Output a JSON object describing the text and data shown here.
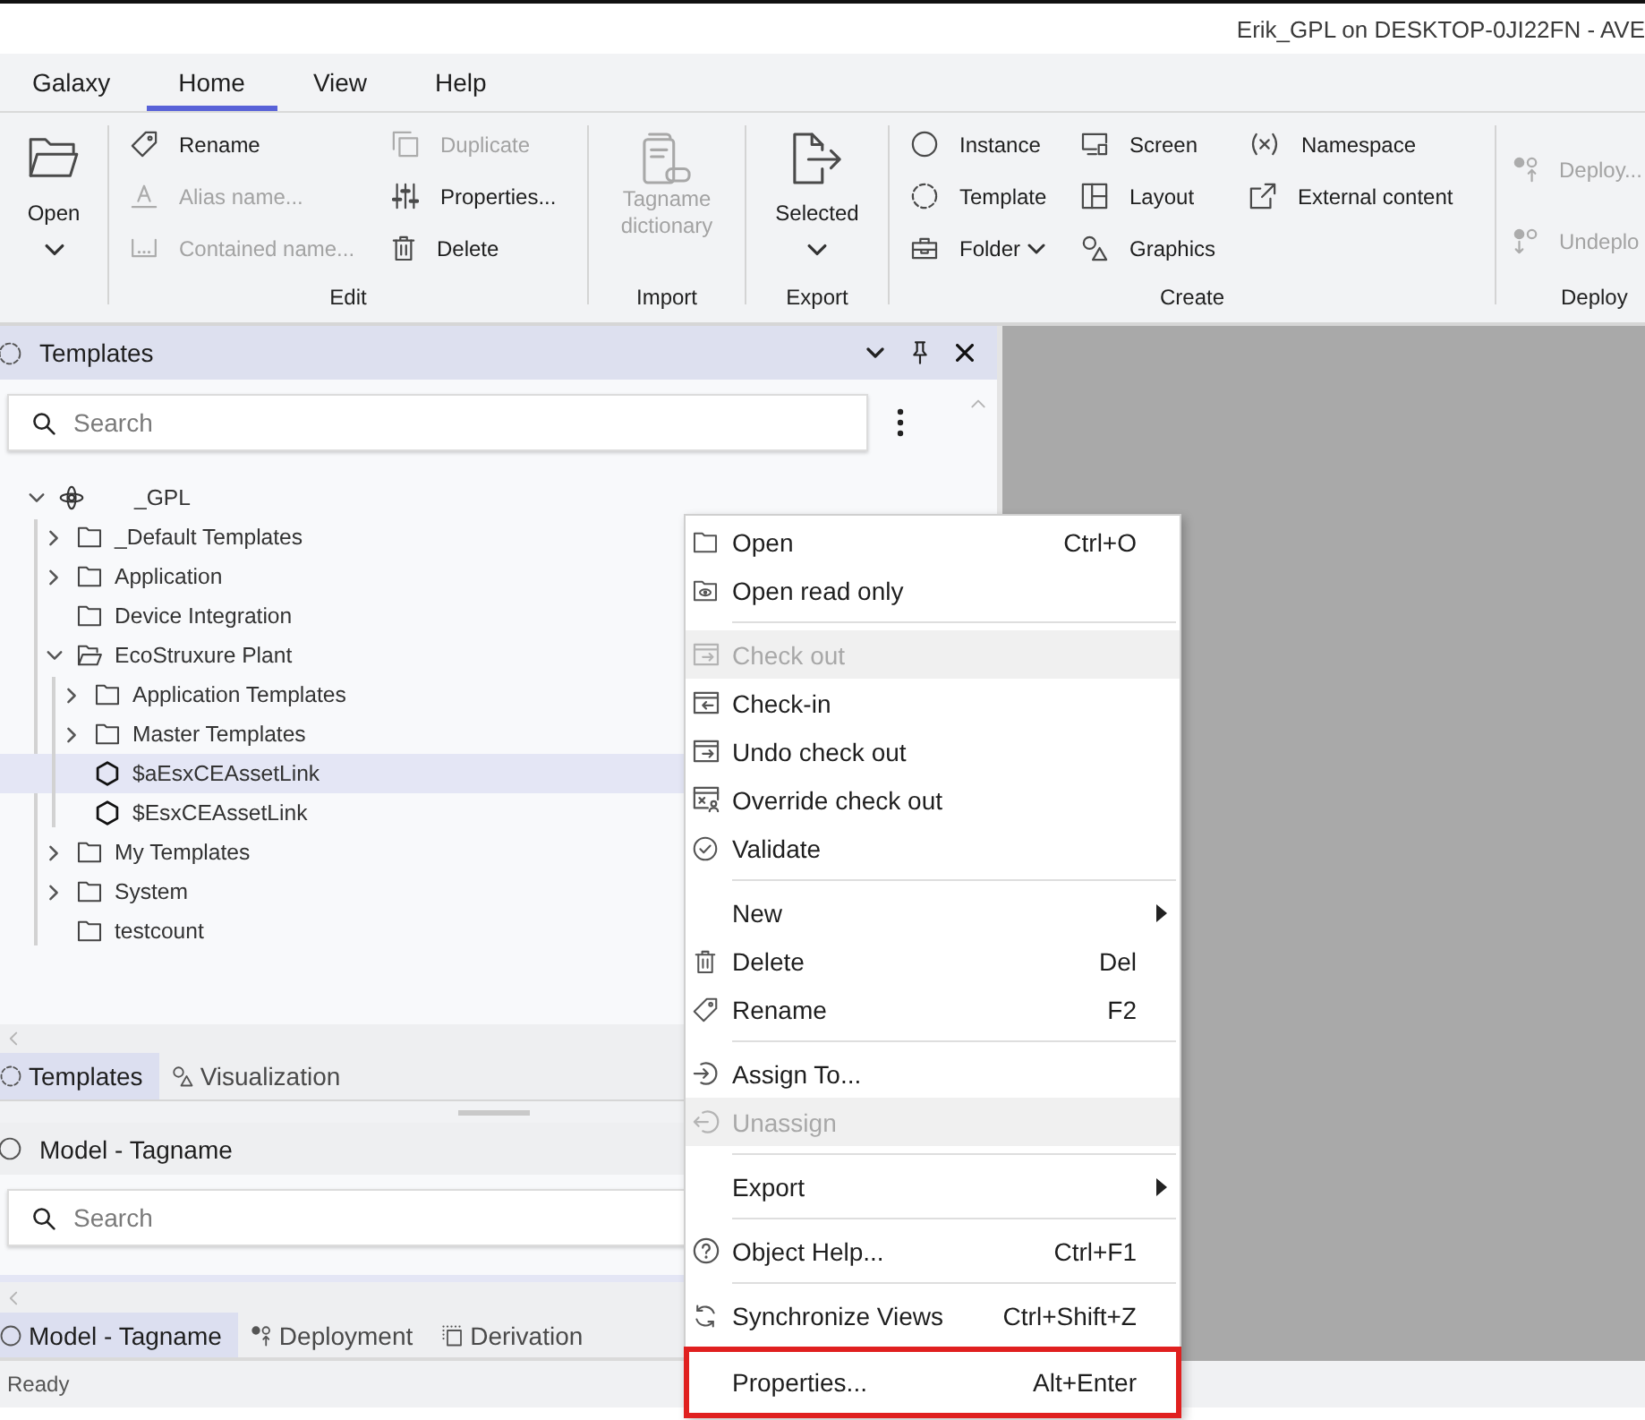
{
  "title_bar": {
    "title": "Erik_GPL on DESKTOP-0JI22FN - AVE"
  },
  "ribbon": {
    "tabs": [
      {
        "label": "Galaxy",
        "selected": false
      },
      {
        "label": "Home",
        "selected": true
      },
      {
        "label": "View",
        "selected": false
      },
      {
        "label": "Help",
        "selected": false
      }
    ],
    "groups": [
      {
        "kind": "large",
        "buttons": [
          {
            "label": "Open",
            "dropdown": true,
            "disabled": false
          }
        ]
      },
      {
        "kind": "small",
        "label": "Edit",
        "columns": [
          [
            {
              "label": "Rename",
              "dropdown": false,
              "disabled": false
            },
            {
              "label": "Alias name...",
              "dropdown": false,
              "disabled": true
            },
            {
              "label": "Contained name...",
              "dropdown": false,
              "disabled": true
            }
          ],
          [
            {
              "label": "Duplicate",
              "dropdown": false,
              "disabled": true
            },
            {
              "label": "Properties...",
              "dropdown": false,
              "disabled": false
            },
            {
              "label": "Delete",
              "dropdown": false,
              "disabled": false
            }
          ]
        ]
      },
      {
        "kind": "large",
        "label": "Import",
        "buttons": [
          {
            "label": "Tagname dictionary",
            "dropdown": false,
            "disabled": true
          }
        ]
      },
      {
        "kind": "large",
        "label": "Export",
        "buttons": [
          {
            "label": "Selected",
            "dropdown": true,
            "disabled": false
          }
        ]
      },
      {
        "kind": "small",
        "label": "Create",
        "columns": [
          [
            {
              "label": "Instance",
              "dropdown": false,
              "disabled": false
            },
            {
              "label": "Template",
              "dropdown": false,
              "disabled": false
            },
            {
              "label": "Folder",
              "dropdown": true,
              "disabled": false
            }
          ],
          [
            {
              "label": "Screen",
              "dropdown": false,
              "disabled": false
            },
            {
              "label": "Layout",
              "dropdown": false,
              "disabled": false
            },
            {
              "label": "Graphics",
              "dropdown": false,
              "disabled": false
            }
          ],
          [
            {
              "label": "Namespace",
              "dropdown": false,
              "disabled": false
            },
            {
              "label": "External content",
              "dropdown": false,
              "disabled": false
            }
          ]
        ]
      },
      {
        "kind": "small",
        "label": "Deploy",
        "columns": [
          [
            {
              "label": "Deploy...",
              "disabled": true
            },
            {
              "label": "Undeplo",
              "disabled": true
            }
          ]
        ]
      }
    ]
  },
  "templates_panel": {
    "title": "Templates",
    "active": true,
    "search": {
      "placeholder": "Search"
    },
    "tree": [
      {
        "label": "_GPL",
        "kind": "galaxy",
        "expandable": true,
        "expanded": true,
        "selected": false,
        "children": [
          {
            "label": "_Default Templates",
            "kind": "folder",
            "expandable": true,
            "expanded": false,
            "selected": false
          },
          {
            "label": "Application",
            "kind": "folder",
            "expandable": true,
            "expanded": false,
            "selected": false
          },
          {
            "label": "Device Integration",
            "kind": "folder",
            "expandable": false,
            "expanded": false,
            "selected": false
          },
          {
            "label": "EcoStruxure Plant",
            "kind": "folder",
            "expandable": true,
            "expanded": true,
            "selected": false,
            "children": [
              {
                "label": "Application Templates",
                "kind": "folder",
                "expandable": true,
                "expanded": false,
                "selected": false
              },
              {
                "label": "Master Templates",
                "kind": "folder",
                "expandable": true,
                "expanded": false,
                "selected": false
              },
              {
                "label": "$aEsxCEAssetLink",
                "kind": "template",
                "expandable": false,
                "expanded": false,
                "selected": true
              },
              {
                "label": "$EsxCEAssetLink",
                "kind": "template",
                "expandable": false,
                "expanded": false,
                "selected": false
              }
            ]
          },
          {
            "label": "My Templates",
            "kind": "folder",
            "expandable": true,
            "expanded": false,
            "selected": false
          },
          {
            "label": "System",
            "kind": "folder",
            "expandable": true,
            "expanded": false,
            "selected": false
          },
          {
            "label": "testcount",
            "kind": "folder",
            "expandable": false,
            "expanded": false,
            "selected": false
          }
        ]
      }
    ],
    "tabs": [
      {
        "label": "Templates",
        "selected": true
      },
      {
        "label": "Visualization",
        "selected": false
      }
    ]
  },
  "model_panel": {
    "title": "Model - Tagname",
    "active": false,
    "search": {
      "placeholder": "Search"
    },
    "tabs": [
      {
        "label": "Model - Tagname",
        "selected": true
      },
      {
        "label": "Deployment",
        "selected": false
      },
      {
        "label": "Derivation",
        "selected": false
      }
    ]
  },
  "status_bar": {
    "text": "Ready"
  },
  "context_menu": {
    "items": [
      {
        "kind": "item",
        "label": "Open",
        "shortcut": "Ctrl+O",
        "disabled": false,
        "submenu": false,
        "outlined": false
      },
      {
        "kind": "item",
        "label": "Open read only",
        "disabled": false,
        "submenu": false,
        "outlined": false
      },
      {
        "kind": "separator"
      },
      {
        "kind": "item",
        "label": "Check out",
        "disabled": true,
        "submenu": false,
        "outlined": false
      },
      {
        "kind": "item",
        "label": "Check-in",
        "disabled": false,
        "submenu": false,
        "outlined": false
      },
      {
        "kind": "item",
        "label": "Undo check out",
        "disabled": false,
        "submenu": false,
        "outlined": false
      },
      {
        "kind": "item",
        "label": "Override check out",
        "disabled": false,
        "submenu": false,
        "outlined": false
      },
      {
        "kind": "item",
        "label": "Validate",
        "disabled": false,
        "submenu": false,
        "outlined": false
      },
      {
        "kind": "separator"
      },
      {
        "kind": "item",
        "label": "New",
        "disabled": false,
        "submenu": true,
        "outlined": false
      },
      {
        "kind": "item",
        "label": "Delete",
        "shortcut": "Del",
        "disabled": false,
        "submenu": false,
        "outlined": false
      },
      {
        "kind": "item",
        "label": "Rename",
        "shortcut": "F2",
        "disabled": false,
        "submenu": false,
        "outlined": false
      },
      {
        "kind": "separator"
      },
      {
        "kind": "item",
        "label": "Assign To...",
        "disabled": false,
        "submenu": false,
        "outlined": false
      },
      {
        "kind": "item",
        "label": "Unassign",
        "disabled": true,
        "submenu": false,
        "outlined": false
      },
      {
        "kind": "separator"
      },
      {
        "kind": "item",
        "label": "Export",
        "disabled": false,
        "submenu": true,
        "outlined": false
      },
      {
        "kind": "separator"
      },
      {
        "kind": "item",
        "label": "Object Help...",
        "shortcut": "Ctrl+F1",
        "disabled": false,
        "submenu": false,
        "outlined": false
      },
      {
        "kind": "separator"
      },
      {
        "kind": "item",
        "label": "Synchronize Views",
        "shortcut": "Ctrl+Shift+Z",
        "disabled": false,
        "submenu": false,
        "outlined": false
      },
      {
        "kind": "separator"
      },
      {
        "kind": "item",
        "label": "Properties...",
        "shortcut": "Alt+Enter",
        "disabled": false,
        "submenu": false,
        "outlined": true
      }
    ]
  }
}
